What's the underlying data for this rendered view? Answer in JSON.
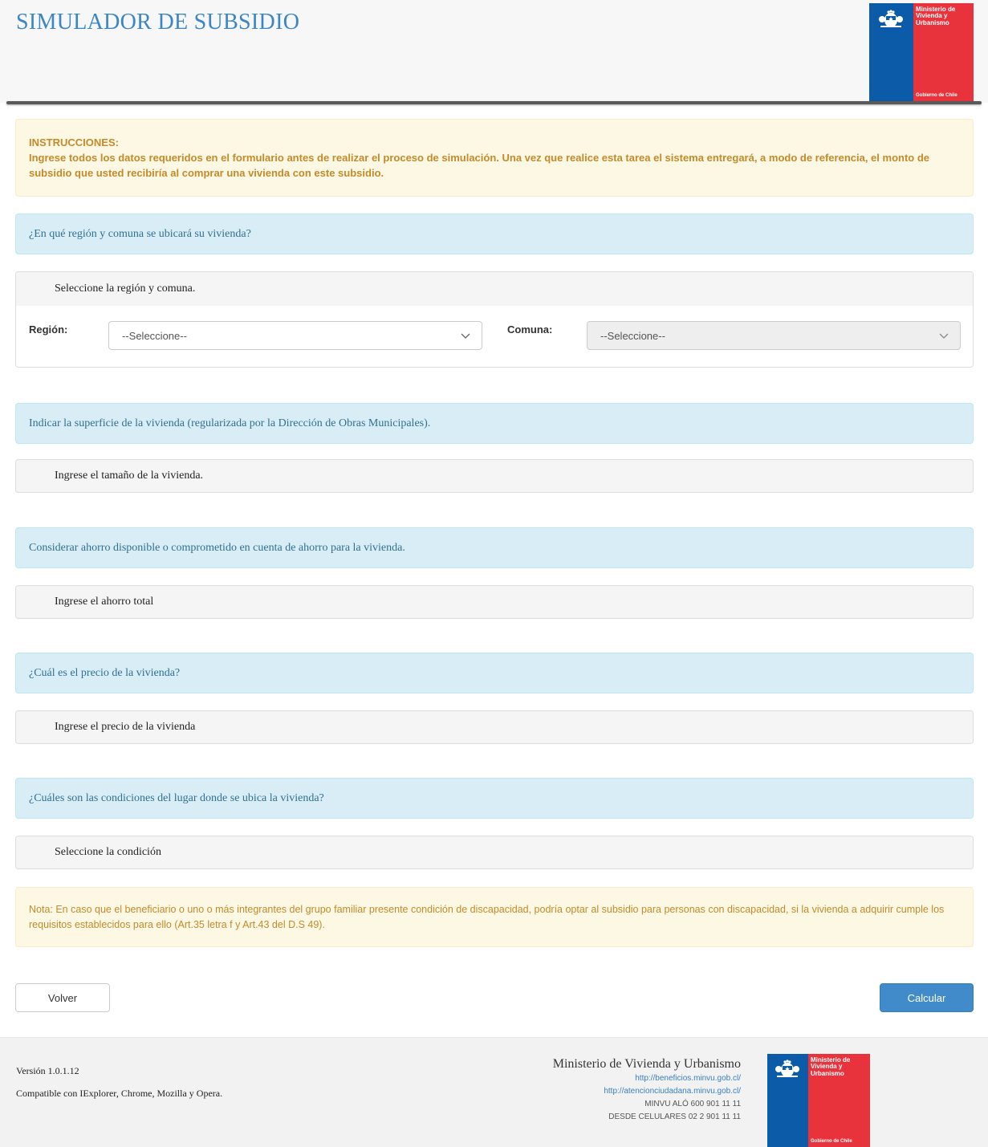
{
  "header": {
    "title": "SIMULADOR DE SUBSIDIO",
    "logo": {
      "line1": "Ministerio de",
      "line2": "Vivienda y",
      "line3": "Urbanismo",
      "gov": "Gobierno de Chile",
      "icon": "chile-coat-of-arms-icon"
    }
  },
  "instructions": {
    "heading": "INSTRUCCIONES:",
    "text": "Ingrese todos los datos requeridos en el formulario antes de realizar el proceso de simulación. Una vez que realice esta tarea el sistema entregará, a modo de referencia, el monto de subsidio que usted recibiría al comprar una vivienda con este subsidio."
  },
  "sections": {
    "location": {
      "question": "¿En qué región y comuna se ubicará su vivienda?",
      "subheading": "Seleccione la región y comuna.",
      "region_label": "Región:",
      "region_value": "--Seleccione--",
      "comuna_label": "Comuna:",
      "comuna_value": "--Seleccione--"
    },
    "surface": {
      "question": "Indicar la superficie de la vivienda (regularizada por la Dirección de Obras Municipales).",
      "subheading": "Ingrese el tamaño de la vivienda."
    },
    "savings": {
      "question": "Considerar ahorro disponible o comprometido en cuenta de ahorro para la vivienda.",
      "subheading": "Ingrese el ahorro total"
    },
    "price": {
      "question": "¿Cuál es el precio de la vivienda?",
      "subheading": "Ingrese el precio de la vivienda"
    },
    "conditions": {
      "question": "¿Cuáles son las condiciones del lugar donde se ubica la vivienda?",
      "subheading": "Seleccione la condición"
    }
  },
  "note": "Nota: En caso que el beneficiario o uno o más integrantes del grupo familiar presente condición de discapacidad, podría optar al subsidio para personas con discapacidad, si la vivienda a adquirir cumple los requisitos establecidos para ello (Art.35 letra f y Art.43 del D.S 49).",
  "buttons": {
    "back": "Volver",
    "calculate": "Calcular"
  },
  "footer": {
    "version": "Versión 1.0.1.12",
    "compat": "Compatible con IExplorer, Chrome, Mozilla y Opera.",
    "ministry": "Ministerio de Vivienda y Urbanismo",
    "link1": "http://beneficios.minvu.gob.cl/",
    "link2": "http://atencionciudadana.minvu.gob.cl/",
    "phone1": "MINVU ALÓ 600 901 11 11",
    "phone2": "DESDE CELULARES 02 2 901 11 11"
  },
  "colors": {
    "title": "#3a86c6",
    "info_panel": "#d9edf7",
    "warning_panel": "#fcf8e3",
    "primary_button": "#428bca",
    "logo_blue": "#0b5ba8",
    "logo_red": "#e8333d"
  }
}
